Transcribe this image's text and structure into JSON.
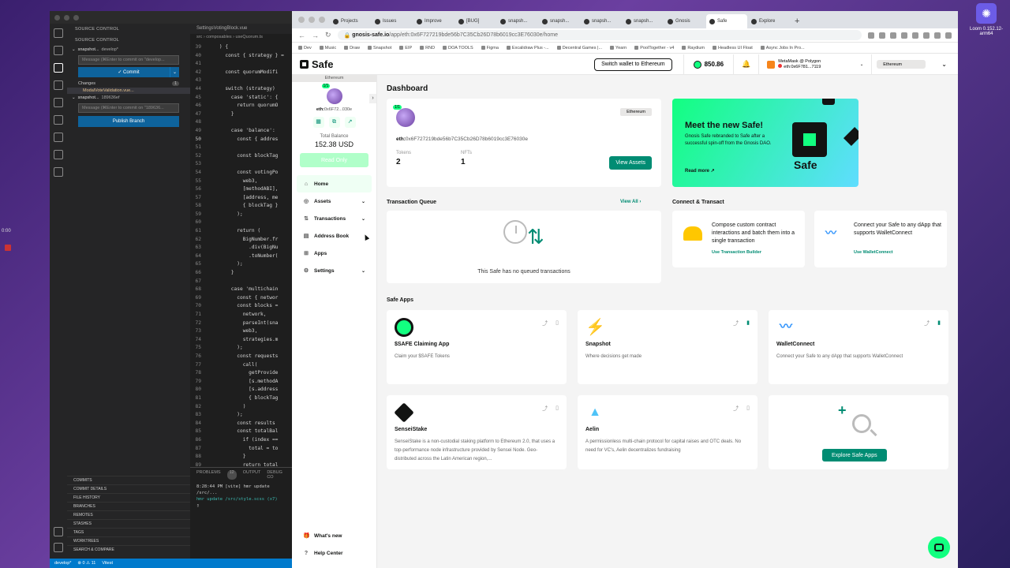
{
  "screen": {
    "recording_time": "0:00"
  },
  "loom": {
    "label": "Loom 0.152.12-arm64"
  },
  "vscode": {
    "source_control_title": "SOURCE CONTROL",
    "section_title": "SOURCE CONTROL",
    "repo1": {
      "name": "snapshot...",
      "branch": "develop*"
    },
    "commit_placeholder1": "Message (⌘Enter to commit on \"develop...",
    "commit_label": "✓ Commit",
    "changes_label": "Changes",
    "changes_count": "1",
    "changed_file": "ModalVoteValidation.vue...",
    "repo2": {
      "name": "snapshot...",
      "branch": "189636ef"
    },
    "commit_placeholder2": "Message (⌘Enter to commit on \"189636...",
    "publish_label": "Publish Branch",
    "sections": [
      "COMMITS",
      "COMMIT DETAILS",
      "FILE HISTORY",
      "BRANCHES",
      "REMOTES",
      "STASHES",
      "TAGS",
      "WORKTREES",
      "SEARCH & COMPARE"
    ],
    "editor_tab": "SettingsVotingBlock.vue",
    "breadcrumb": "src › composables › useQuorum.ts",
    "code": [
      {
        "n": "39",
        "t": "    ) {"
      },
      {
        "n": "40",
        "t": "      const { strategy } ="
      },
      {
        "n": "41",
        "t": ""
      },
      {
        "n": "42",
        "t": "      const quorumModifi"
      },
      {
        "n": "43",
        "t": ""
      },
      {
        "n": "44",
        "t": "      switch (strategy)"
      },
      {
        "n": "45",
        "t": "        case 'static': {"
      },
      {
        "n": "46",
        "t": "          return quorumO"
      },
      {
        "n": "47",
        "t": "        }"
      },
      {
        "n": "48",
        "t": ""
      },
      {
        "n": "49",
        "t": "        case 'balance':"
      },
      {
        "n": "50",
        "t": "          const { addres"
      },
      {
        "n": "51",
        "t": ""
      },
      {
        "n": "52",
        "t": "          const blockTag"
      },
      {
        "n": "53",
        "t": ""
      },
      {
        "n": "54",
        "t": "          const votingPo"
      },
      {
        "n": "55",
        "t": "            web3,"
      },
      {
        "n": "56",
        "t": "            [methodABI],"
      },
      {
        "n": "57",
        "t": "            [address, me"
      },
      {
        "n": "58",
        "t": "            { blockTag }"
      },
      {
        "n": "59",
        "t": "          );"
      },
      {
        "n": "60",
        "t": ""
      },
      {
        "n": "61",
        "t": "          return ("
      },
      {
        "n": "62",
        "t": "            BigNumber.fr"
      },
      {
        "n": "63",
        "t": "              .div(BigNu"
      },
      {
        "n": "64",
        "t": "              .toNumber("
      },
      {
        "n": "65",
        "t": "          );"
      },
      {
        "n": "66",
        "t": "        }"
      },
      {
        "n": "67",
        "t": ""
      },
      {
        "n": "68",
        "t": "        case 'multichain"
      },
      {
        "n": "69",
        "t": "          const { networ"
      },
      {
        "n": "70",
        "t": "          const blocks ="
      },
      {
        "n": "71",
        "t": "            network,"
      },
      {
        "n": "72",
        "t": "            parseInt(sna"
      },
      {
        "n": "73",
        "t": "            web3,"
      },
      {
        "n": "74",
        "t": "            strategies.m"
      },
      {
        "n": "75",
        "t": "          );"
      },
      {
        "n": "76",
        "t": "          const requests"
      },
      {
        "n": "77",
        "t": "            call("
      },
      {
        "n": "78",
        "t": "              getProvide"
      },
      {
        "n": "79",
        "t": "              [s.methodA"
      },
      {
        "n": "80",
        "t": "              [s.address"
      },
      {
        "n": "81",
        "t": "              { blockTag"
      },
      {
        "n": "82",
        "t": "            )"
      },
      {
        "n": "83",
        "t": "          );"
      },
      {
        "n": "84",
        "t": "          const results"
      },
      {
        "n": "85",
        "t": "          const totalBal"
      },
      {
        "n": "86",
        "t": "            if (index =="
      },
      {
        "n": "87",
        "t": "              total = to"
      },
      {
        "n": "88",
        "t": "            }"
      },
      {
        "n": "89",
        "t": "            return total"
      }
    ],
    "panel_tabs": {
      "problems": "PROBLEMS",
      "problems_count": "12",
      "output": "OUTPUT",
      "debug": "DEBUG CO"
    },
    "terminal_lines": [
      "8:28:44 PM [vite] hmr update /src/...",
      "hmr update /src/style.scss (x7)"
    ],
    "status": {
      "branch": "develop*",
      "problems": "⊗ 0 ⚠ 11",
      "vitest": "Vitest"
    }
  },
  "browser": {
    "tabs": [
      "Projects",
      "Issues",
      "Improve",
      "[BUG]",
      "snapsh...",
      "snapsh...",
      "snapsh...",
      "snapsh...",
      "Gnosis",
      "Safe",
      "Explore"
    ],
    "url_host": "gnosis-safe.io",
    "url_path": "/app/eth:0x6F727219bde56b7C35Cb26D78b6019cc3E76030e/home",
    "bookmarks": [
      "Dev",
      "Music",
      "Draw",
      "Snapshot",
      "EIP",
      "RND",
      "DOA TOOLS",
      "Figma",
      "Excalidraw Plus -...",
      "Decentral Games |...",
      "Yearn",
      "PoolTogether - v4",
      "Raydium",
      "Headless UI Float",
      "Async Jobs In Pro..."
    ]
  },
  "safe": {
    "logo": "Safe",
    "switch_wallet": "Switch wallet to  Ethereum",
    "balance": "850.86",
    "wallet_name": "MetaMask @ Polygon",
    "wallet_addr": "eth:0x6F781...7119",
    "network": "Ethereum",
    "sidebar": {
      "network": "Ethereum",
      "threshold": "1/1",
      "addr_prefix": "eth:",
      "addr": "0x6F72...030e",
      "total_balance_label": "Total Balance",
      "total_balance": "152.38 USD",
      "read_only": "Read Only",
      "nav": [
        {
          "label": "Home",
          "icon": "⌂"
        },
        {
          "label": "Assets",
          "icon": "◎"
        },
        {
          "label": "Transactions",
          "icon": "⇅"
        },
        {
          "label": "Address Book",
          "icon": "▤"
        },
        {
          "label": "Apps",
          "icon": "⊞"
        },
        {
          "label": "Settings",
          "icon": "⚙"
        }
      ],
      "whats_new": "What's new",
      "help_center": "Help Center"
    },
    "dashboard": {
      "title": "Dashboard",
      "threshold": "1/1",
      "network": "Ethereum",
      "addr_prefix": "eth:",
      "address": "0x6F727219bde56b7C35Cb26D78b6019cc3E76030e",
      "tokens_label": "Tokens",
      "tokens": "2",
      "nfts_label": "NFTs",
      "nfts": "1",
      "view_assets": "View Assets",
      "promo_title": "Meet the new Safe!",
      "promo_desc": "Gnosis Safe rebranded to Safe after a successful spin-off from the Gnosis DAO.",
      "promo_read": "Read more ↗",
      "promo_logo": "Safe",
      "queue_title": "Transaction Queue",
      "view_all": "View All  ›",
      "queue_empty": "This Safe has no queued transactions",
      "connect_title": "Connect & Transact",
      "tx_builder_desc": "Compose custom contract interactions and batch them into a single transaction",
      "tx_builder_link": "Use Transaction Builder",
      "walletconnect_desc": "Connect your Safe to any dApp that supports WalletConnect",
      "walletconnect_link": "Use WalletConnect",
      "apps_title": "Safe Apps",
      "apps": [
        {
          "name": "$SAFE Claiming App",
          "desc": "Claim your $SAFE Tokens"
        },
        {
          "name": "Snapshot",
          "desc": "Where decisions get made"
        },
        {
          "name": "WalletConnect",
          "desc": "Connect your Safe to any dApp that supports WalletConnect"
        },
        {
          "name": "SenseiStake",
          "desc": "SenseiStake is a non-custodial staking platform to Ethereum 2.0, that uses a top-performance node infrastructure provided by Sensei Node. Geo-distributed across the Latin American region,..."
        },
        {
          "name": "Aelin",
          "desc": "A permissionless multi-chain protocol for capital raises and OTC deals. No need for VC's, Aelin decentralizes fundraising"
        }
      ],
      "explore_apps": "Explore Safe Apps"
    }
  },
  "colors": {
    "safe_green": "#12ff80",
    "safe_dark_green": "#008c73",
    "vscode_blue": "#007acc"
  }
}
